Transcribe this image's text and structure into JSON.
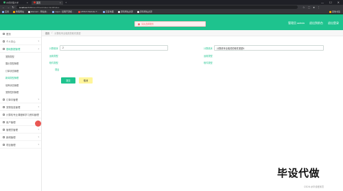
{
  "browser": {
    "tabs": [
      {
        "label": "水费管理大学",
        "active": false
      },
      {
        "label": "首页",
        "active": true
      }
    ],
    "window_controls": [
      "—",
      "☐",
      "✕"
    ],
    "address": {
      "host": "localhost",
      "path": ":8080/ssm7/front/index.html#/index"
    },
    "bookmarks": [
      {
        "label": "应用"
      },
      {
        "label": "教程网站"
      },
      {
        "label": "Element - 网站快..."
      },
      {
        "label": "Layui - 经典开源模..."
      },
      {
        "label": "HTML5 Website T..."
      },
      {
        "label": "百度地图"
      },
      {
        "label": "源码网站资源"
      },
      {
        "label": "源码网站资源"
      }
    ],
    "bookmarks_end": "其他书签"
  },
  "header": {
    "links": [
      "管理员 admin",
      "退出到前台",
      "退出登录"
    ]
  },
  "toast": {
    "text": "请先选择服务"
  },
  "sidebar": {
    "items": [
      {
        "label": "首页",
        "type": "item"
      },
      {
        "label": "个人中心",
        "type": "item",
        "chevron": "▾"
      },
      {
        "label": "基础数据管理",
        "type": "item",
        "chevron": "▴",
        "open": true
      },
      {
        "label": "宠物类型",
        "type": "sub"
      },
      {
        "label": "展示类型管理",
        "type": "sub"
      },
      {
        "label": "订单状态管理",
        "type": "sub"
      },
      {
        "label": "新闻类型管理",
        "type": "sub",
        "active": true
      },
      {
        "label": "领养状态管理",
        "type": "sub"
      },
      {
        "label": "宠物性别管理",
        "type": "sub"
      },
      {
        "label": "订单中管理",
        "type": "item",
        "chevron": "▾"
      },
      {
        "label": "宠物信息管理",
        "type": "item",
        "chevron": "▾"
      },
      {
        "label": "计算机专业课程和学习资料管理",
        "type": "item",
        "chevron": "▾"
      },
      {
        "label": "用户管理",
        "type": "item",
        "chevron": "▾"
      },
      {
        "label": "管理员管理",
        "type": "item",
        "chevron": "▾"
      },
      {
        "label": "新闻管理",
        "type": "item",
        "chevron": "▾"
      },
      {
        "label": "项目管理",
        "type": "item",
        "chevron": "▾"
      }
    ]
  },
  "breadcrumb": {
    "home": "首页",
    "separator": "/",
    "current": "计算机专业相关的软件类型"
  },
  "form": {
    "field1": {
      "label": "计算机序",
      "value": "2"
    },
    "field2": {
      "label": "计算机序",
      "value": "计算机专业相关的软件类型5"
    },
    "label_left_1": "运用类型",
    "label_left_2": "软件类型",
    "label_right_1": "运用类型",
    "label_right_2": "软件类型",
    "label_left_3": "项目",
    "submit_label": "提交",
    "cancel_label": "取消"
  },
  "watermark": "毕设代做",
  "csdn": "CSDN @毕设程序员"
}
